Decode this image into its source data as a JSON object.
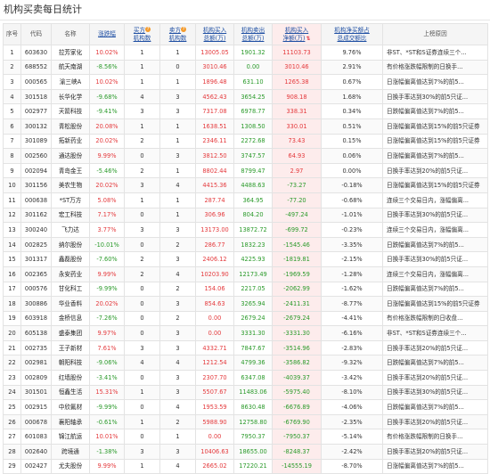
{
  "title": "机构买卖每日统计",
  "headers": {
    "rank": "序号",
    "code": "代码",
    "name": "名称",
    "change": "涨跌幅",
    "buy_count_line1": "买方",
    "buy_count_line2": "机构数",
    "sell_count_line1": "卖方",
    "sell_count_line2": "机构数",
    "buy_amt_line1": "机构买入",
    "buy_amt_line2": "总额(万)",
    "sell_amt_line1": "机构卖出",
    "sell_amt_line2": "总额(万)",
    "net_line1": "机构买入",
    "net_line2": "净额(万)",
    "ratio_line1": "机构净买额占",
    "ratio_line2": "总成交额比",
    "reason": "上榜原因",
    "help_glyph": "?",
    "sort_glyph": "⇅"
  },
  "rows": [
    {
      "rank": "1",
      "code": "603630",
      "name": "拉芳家化",
      "change": "10.02%",
      "buy": "1",
      "sell": "1",
      "buy_amt": "13005.05",
      "sell_amt": "1901.32",
      "net": "11103.73",
      "ratio": "9.76%",
      "reason": "非ST、*ST和S证券连续三个..."
    },
    {
      "rank": "2",
      "code": "688552",
      "name": "航天南湖",
      "change": "-8.56%",
      "buy": "1",
      "sell": "0",
      "buy_amt": "3010.46",
      "sell_amt": "0.00",
      "net": "3010.46",
      "ratio": "2.91%",
      "reason": "有价格涨跌幅限制的日换手..."
    },
    {
      "rank": "3",
      "code": "000565",
      "name": "渝三峡A",
      "change": "10.02%",
      "buy": "1",
      "sell": "1",
      "buy_amt": "1896.48",
      "sell_amt": "631.10",
      "net": "1265.38",
      "ratio": "0.67%",
      "reason": "日涨幅偏离值达到7%的前5..."
    },
    {
      "rank": "4",
      "code": "301518",
      "name": "长华化学",
      "change": "-9.68%",
      "buy": "4",
      "sell": "3",
      "buy_amt": "4562.43",
      "sell_amt": "3654.25",
      "net": "908.18",
      "ratio": "1.68%",
      "reason": "日换手率达到30%的前5只证..."
    },
    {
      "rank": "5",
      "code": "002977",
      "name": "天箭科技",
      "change": "-9.41%",
      "buy": "3",
      "sell": "3",
      "buy_amt": "7317.08",
      "sell_amt": "6978.77",
      "net": "338.31",
      "ratio": "0.34%",
      "reason": "日跌幅偏离值达到7%的前5..."
    },
    {
      "rank": "6",
      "code": "300132",
      "name": "青松股份",
      "change": "20.08%",
      "buy": "1",
      "sell": "1",
      "buy_amt": "1638.51",
      "sell_amt": "1308.50",
      "net": "330.01",
      "ratio": "0.51%",
      "reason": "日涨幅偏离值达到15%的前5只证券"
    },
    {
      "rank": "7",
      "code": "301089",
      "name": "拓新药业",
      "change": "20.02%",
      "buy": "2",
      "sell": "1",
      "buy_amt": "2346.11",
      "sell_amt": "2272.68",
      "net": "73.43",
      "ratio": "0.15%",
      "reason": "日涨幅偏离值达到15%的前5只证券"
    },
    {
      "rank": "8",
      "code": "002560",
      "name": "通达股份",
      "change": "9.99%",
      "buy": "0",
      "sell": "3",
      "buy_amt": "3812.50",
      "sell_amt": "3747.57",
      "net": "64.93",
      "ratio": "0.06%",
      "reason": "日涨幅偏离值达到7%的前5..."
    },
    {
      "rank": "9",
      "code": "002094",
      "name": "青岛金王",
      "change": "-5.46%",
      "buy": "2",
      "sell": "1",
      "buy_amt": "8802.44",
      "sell_amt": "8799.47",
      "net": "2.97",
      "ratio": "0.00%",
      "reason": "日换手率达到20%的前5只证..."
    },
    {
      "rank": "10",
      "code": "301156",
      "name": "美农生物",
      "change": "20.02%",
      "buy": "3",
      "sell": "4",
      "buy_amt": "4415.36",
      "sell_amt": "4488.63",
      "net": "-73.27",
      "ratio": "-0.18%",
      "reason": "日涨幅偏离值达到15%的前5只证券"
    },
    {
      "rank": "11",
      "code": "000638",
      "name": "*ST万方",
      "change": "5.08%",
      "buy": "1",
      "sell": "1",
      "buy_amt": "287.74",
      "sell_amt": "364.95",
      "net": "-77.20",
      "ratio": "-0.68%",
      "reason": "连续三个交易日内，涨幅偏离..."
    },
    {
      "rank": "12",
      "code": "301162",
      "name": "宏工科技",
      "change": "7.17%",
      "buy": "0",
      "sell": "1",
      "buy_amt": "306.96",
      "sell_amt": "804.20",
      "net": "-497.24",
      "ratio": "-1.01%",
      "reason": "日换手率达到30%的前5只证..."
    },
    {
      "rank": "13",
      "code": "300240",
      "name": "飞力达",
      "change": "3.77%",
      "buy": "3",
      "sell": "3",
      "buy_amt": "13173.00",
      "sell_amt": "13872.72",
      "net": "-699.72",
      "ratio": "-0.23%",
      "reason": "连续三个交易日内，涨幅偏离..."
    },
    {
      "rank": "14",
      "code": "002825",
      "name": "纳尔股份",
      "change": "-10.01%",
      "buy": "0",
      "sell": "2",
      "buy_amt": "286.77",
      "sell_amt": "1832.23",
      "net": "-1545.46",
      "ratio": "-3.35%",
      "reason": "日跌幅偏离值达到7%的前5..."
    },
    {
      "rank": "15",
      "code": "301317",
      "name": "鑫磊股份",
      "change": "-7.60%",
      "buy": "2",
      "sell": "3",
      "buy_amt": "2406.12",
      "sell_amt": "4225.93",
      "net": "-1819.81",
      "ratio": "-2.15%",
      "reason": "日换手率达到30%的前5只证..."
    },
    {
      "rank": "16",
      "code": "002365",
      "name": "永安药业",
      "change": "9.99%",
      "buy": "2",
      "sell": "4",
      "buy_amt": "10203.90",
      "sell_amt": "12173.49",
      "net": "-1969.59",
      "ratio": "-1.28%",
      "reason": "连续三个交易日内，涨幅偏离..."
    },
    {
      "rank": "17",
      "code": "000576",
      "name": "甘化科工",
      "change": "-9.99%",
      "buy": "0",
      "sell": "2",
      "buy_amt": "154.06",
      "sell_amt": "2217.05",
      "net": "-2062.99",
      "ratio": "-1.62%",
      "reason": "日跌幅偏离值达到7%的前5..."
    },
    {
      "rank": "18",
      "code": "300886",
      "name": "华业香料",
      "change": "20.02%",
      "buy": "0",
      "sell": "3",
      "buy_amt": "854.63",
      "sell_amt": "3265.94",
      "net": "-2411.31",
      "ratio": "-8.77%",
      "reason": "日涨幅偏离值达到15%的前5只证券"
    },
    {
      "rank": "19",
      "code": "603918",
      "name": "金桥信息",
      "change": "-7.26%",
      "buy": "0",
      "sell": "2",
      "buy_amt": "0.00",
      "sell_amt": "2679.24",
      "net": "-2679.24",
      "ratio": "-4.41%",
      "reason": "有价格涨跌幅限制的日收盘..."
    },
    {
      "rank": "20",
      "code": "605138",
      "name": "盛泰集团",
      "change": "9.97%",
      "buy": "0",
      "sell": "3",
      "buy_amt": "0.00",
      "sell_amt": "3331.30",
      "net": "-3331.30",
      "ratio": "-6.16%",
      "reason": "非ST、*ST和S证券连续三个..."
    },
    {
      "rank": "21",
      "code": "002735",
      "name": "王子新材",
      "change": "7.61%",
      "buy": "3",
      "sell": "3",
      "buy_amt": "4332.71",
      "sell_amt": "7847.67",
      "net": "-3514.96",
      "ratio": "-2.83%",
      "reason": "日换手率达到20%的前5只证..."
    },
    {
      "rank": "22",
      "code": "002981",
      "name": "朝阳科技",
      "change": "-9.06%",
      "buy": "4",
      "sell": "4",
      "buy_amt": "1212.54",
      "sell_amt": "4799.36",
      "net": "-3586.82",
      "ratio": "-9.32%",
      "reason": "日跌幅偏离值达到7%的前5..."
    },
    {
      "rank": "23",
      "code": "002809",
      "name": "红墙股份",
      "change": "-3.41%",
      "buy": "0",
      "sell": "3",
      "buy_amt": "2307.70",
      "sell_amt": "6347.08",
      "net": "-4039.37",
      "ratio": "-3.42%",
      "reason": "日换手率达到20%的前5只证..."
    },
    {
      "rank": "24",
      "code": "301501",
      "name": "恒鑫生活",
      "change": "15.31%",
      "buy": "1",
      "sell": "3",
      "buy_amt": "5507.67",
      "sell_amt": "11483.06",
      "net": "-5975.40",
      "ratio": "-8.10%",
      "reason": "日换手率达到30%的前5只证..."
    },
    {
      "rank": "25",
      "code": "002915",
      "name": "中欣氟材",
      "change": "-9.99%",
      "buy": "0",
      "sell": "4",
      "buy_amt": "1953.59",
      "sell_amt": "8630.48",
      "net": "-6676.89",
      "ratio": "-4.06%",
      "reason": "日跌幅偏离值达到7%的前5..."
    },
    {
      "rank": "26",
      "code": "000678",
      "name": "襄阳轴承",
      "change": "-0.61%",
      "buy": "1",
      "sell": "2",
      "buy_amt": "5988.90",
      "sell_amt": "12758.80",
      "net": "-6769.90",
      "ratio": "-2.35%",
      "reason": "日换手率达到20%的前5只证..."
    },
    {
      "rank": "27",
      "code": "601083",
      "name": "锦江航运",
      "change": "10.01%",
      "buy": "0",
      "sell": "1",
      "buy_amt": "0.00",
      "sell_amt": "7950.37",
      "net": "-7950.37",
      "ratio": "-5.14%",
      "reason": "有价格涨跌幅限制的日换手..."
    },
    {
      "rank": "28",
      "code": "002640",
      "name": "跨境通",
      "change": "-1.38%",
      "buy": "3",
      "sell": "3",
      "buy_amt": "10406.63",
      "sell_amt": "18655.00",
      "net": "-8248.37",
      "ratio": "-2.42%",
      "reason": "日换手率达到20%的前5只证..."
    },
    {
      "rank": "29",
      "code": "002427",
      "name": "尤夫股份",
      "change": "9.99%",
      "buy": "1",
      "sell": "4",
      "buy_amt": "2665.02",
      "sell_amt": "17220.21",
      "net": "-14555.19",
      "ratio": "-8.70%",
      "reason": "日涨幅偏离值达到7%的前5..."
    }
  ],
  "colors": {
    "up": "#e4393c",
    "down": "#2a9a2a",
    "selected_column_bg": "#fdecec",
    "help_icon": "#f39a2b"
  }
}
